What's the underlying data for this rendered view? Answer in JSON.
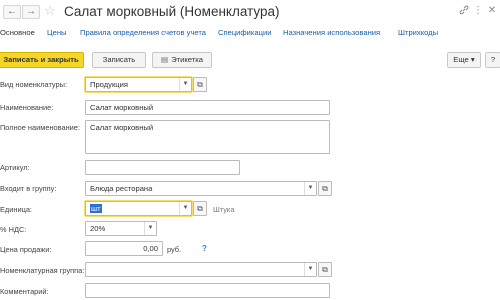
{
  "window": {
    "back_icon": "arrow-left-icon",
    "forward_icon": "arrow-right-icon",
    "favorite_icon": "star-icon",
    "title": "Салат морковный (Номенклатура)",
    "link_icon": "link-icon",
    "menu_icon": "more-vertical-icon",
    "close_icon": "close-icon"
  },
  "tabs": [
    "Основное",
    "Цены",
    "Правила определения счетов учета",
    "Спецификации",
    "Назначения использования",
    "Штрихкоды"
  ],
  "toolbar": {
    "save_close": "Записать и закрыть",
    "save": "Записать",
    "label_button": "Этикетка",
    "more": "Еще",
    "help": "?"
  },
  "form": {
    "type": {
      "label": "Вид номенклатуры:",
      "value": "Продукция"
    },
    "name": {
      "label": "Наименование:",
      "value": "Салат морковный"
    },
    "full_name": {
      "label": "Полное наименование:",
      "value": "Салат морковный"
    },
    "article": {
      "label": "Артикул:",
      "value": ""
    },
    "group": {
      "label": "Входит в группу:",
      "value": "Блюда ресторана"
    },
    "unit": {
      "label": "Единица:",
      "value": "шт",
      "hint": "Штука"
    },
    "vat": {
      "label": "% НДС:",
      "value": "20%"
    },
    "price": {
      "label": "Цена продажи:",
      "value": "0,00",
      "currency": "руб.",
      "help": "?"
    },
    "nom_group": {
      "label": "Номенклатурная группа:",
      "value": ""
    },
    "comment": {
      "label": "Комментарий:",
      "value": ""
    }
  }
}
